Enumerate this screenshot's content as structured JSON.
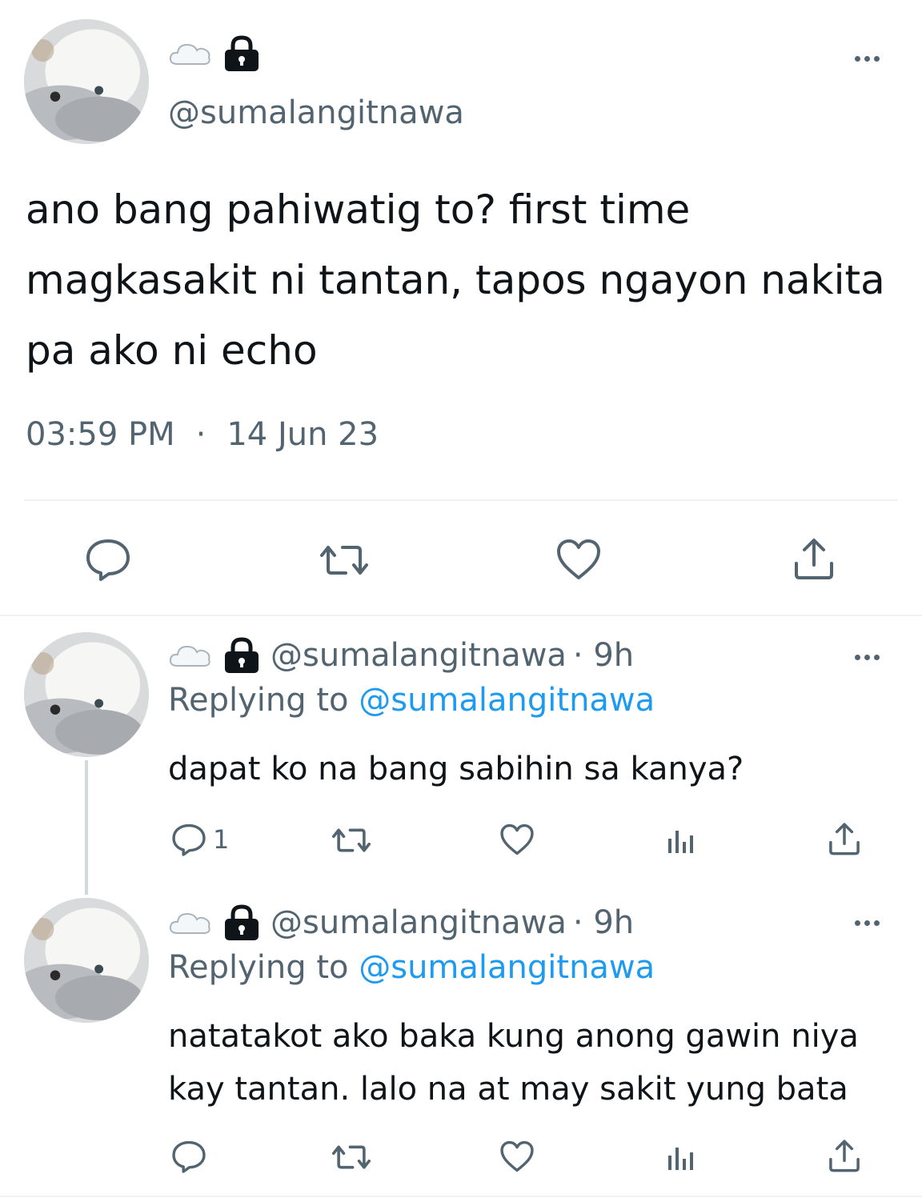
{
  "tweet": {
    "handle": "@sumalangitnawa",
    "text": "ano bang pahiwatig to? first time magkasakit ni tantan, tapos ngayon nakita pa ako ni echo",
    "time": "03:59 PM",
    "separator": "·",
    "date": "14 Jun 23",
    "icons": [
      "cloud-icon",
      "lock-icon",
      "more-icon",
      "reply-icon",
      "retweet-icon",
      "like-icon",
      "share-icon"
    ]
  },
  "replies": [
    {
      "handle": "@sumalangitnawa",
      "age": "· 9h",
      "replying_prefix": "Replying to",
      "replying_to": "@sumalangitnawa",
      "text": "dapat ko na bang sabihin sa kanya?",
      "reply_count": "1"
    },
    {
      "handle": "@sumalangitnawa",
      "age": "· 9h",
      "replying_prefix": "Replying to",
      "replying_to": "@sumalangitnawa",
      "text": "natatakot ako baka kung anong gawin niya kay tantan. lalo na at may sakit yung bata",
      "reply_count": ""
    }
  ],
  "colors": {
    "text": "#0f1419",
    "secondary": "#536471",
    "link": "#1d9bf0",
    "divider": "#eff3f4",
    "thread_line": "#cfd9de"
  }
}
